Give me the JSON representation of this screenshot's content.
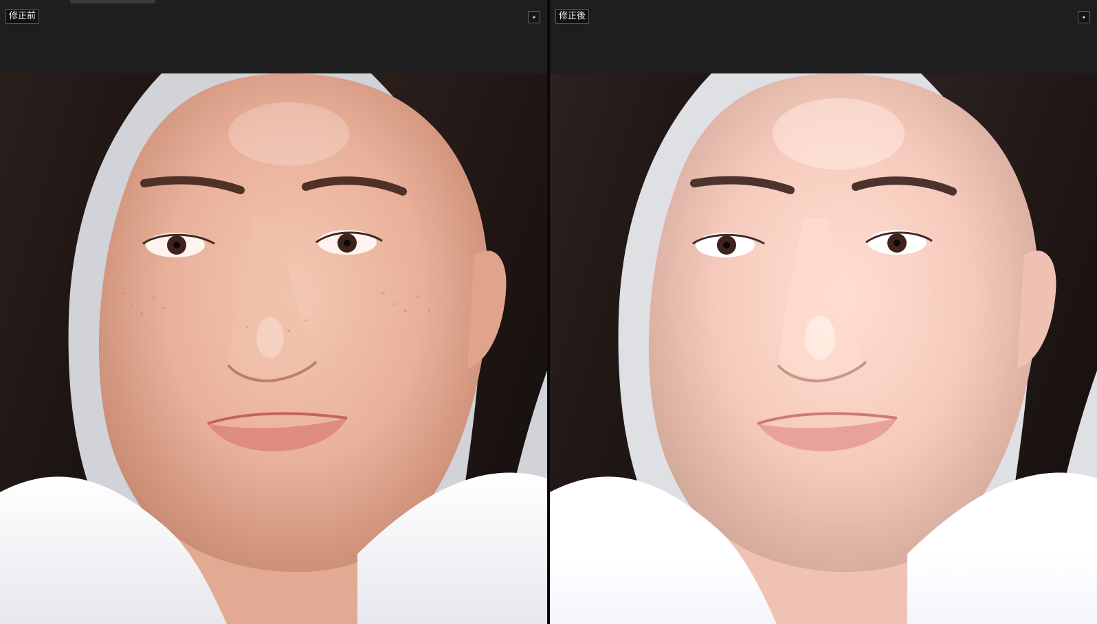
{
  "left_panel": {
    "label": "修正前",
    "icon": "restore-window-icon"
  },
  "right_panel": {
    "label": "修正後",
    "icon": "restore-window-icon"
  },
  "colors": {
    "background": "#1d1d1d",
    "divider": "#050505",
    "label_border": "#5d5d5d",
    "label_text": "#f2f2f2"
  }
}
